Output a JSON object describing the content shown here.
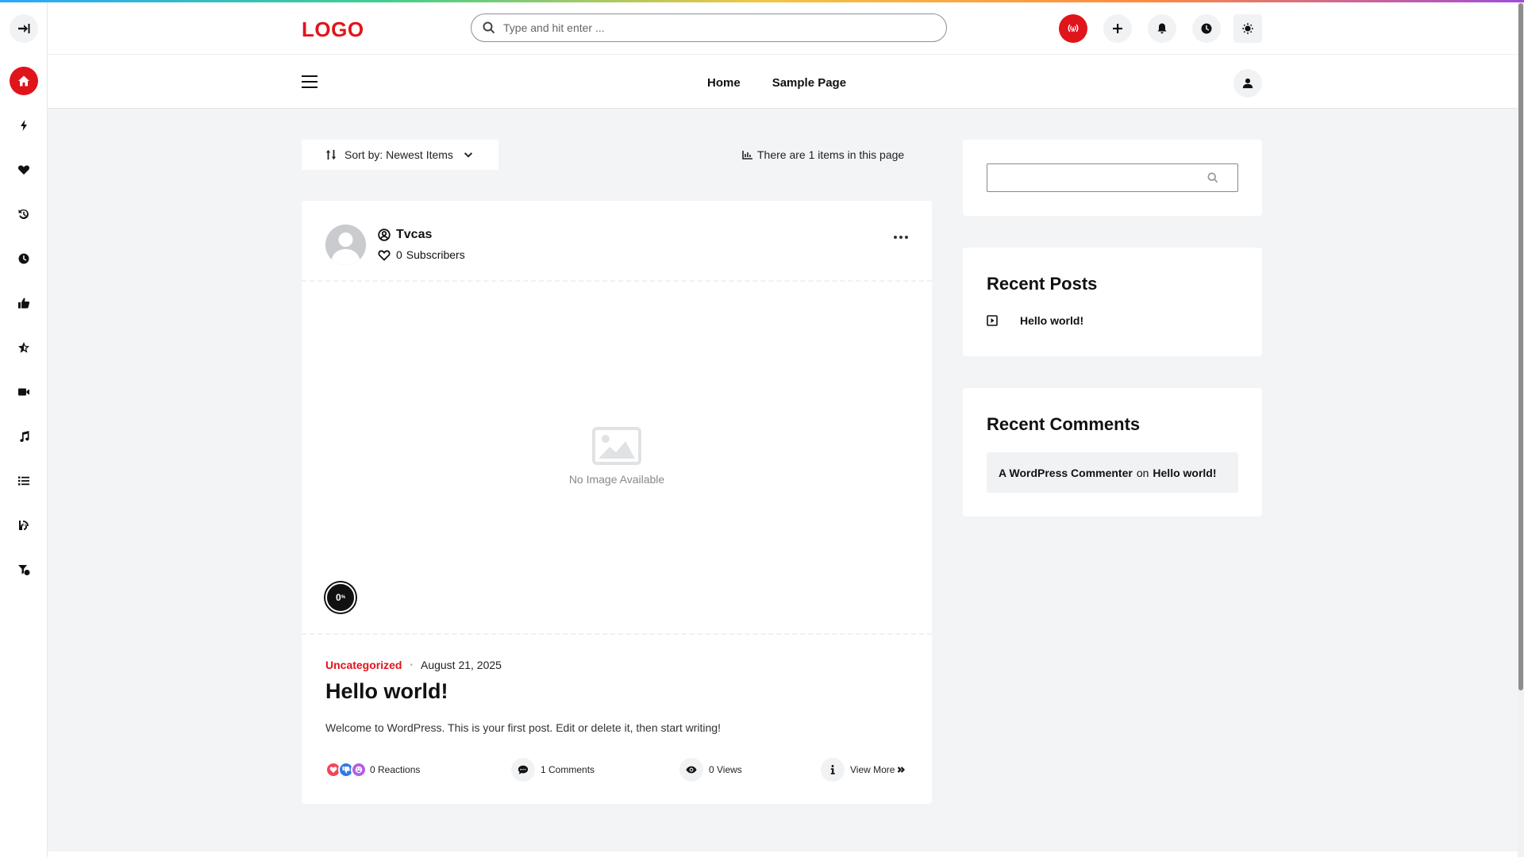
{
  "header": {
    "logo": "LOGO",
    "search_placeholder": "Type and hit enter ...",
    "nav": [
      "Home",
      "Sample Page"
    ]
  },
  "toolbar": {
    "sort_label": "Sort by: Newest Items",
    "items_count": "There are 1 items in this page"
  },
  "post": {
    "author": "Tvcas",
    "subscribers_count": "0",
    "subscribers_label": "Subscribers",
    "no_image": "No Image Available",
    "percent": "0",
    "percent_sign": "%",
    "category": "Uncategorized",
    "date": "August 21, 2025",
    "title": "Hello world!",
    "excerpt": "Welcome to WordPress. This is your first post. Edit or delete it, then start writing!",
    "reactions": "0 Reactions",
    "comments": "1 Comments",
    "views": "0 Views",
    "view_more": "View More"
  },
  "sidebar": {
    "recent_posts_title": "Recent Posts",
    "recent_posts": [
      "Hello world!"
    ],
    "recent_comments_title": "Recent Comments",
    "comment_author": "A WordPress Commenter",
    "comment_on": "on",
    "comment_post": "Hello world!"
  },
  "colors": {
    "accent": "#e0141b",
    "background": "#f3f4f6"
  },
  "rail_icons": [
    "sidebar-toggle-icon",
    "home-icon",
    "lightning-icon",
    "heart-icon",
    "history-icon",
    "clock-icon",
    "thumbs-up-icon",
    "star-icon",
    "video-icon",
    "music-icon",
    "list-icon",
    "blog-icon",
    "filter-icon"
  ]
}
